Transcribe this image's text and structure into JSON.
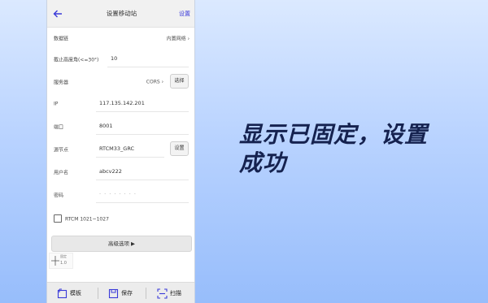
{
  "header": {
    "title": "设置移动站",
    "action_label": "设置"
  },
  "rows": {
    "datalink": {
      "label": "数据链",
      "value": "内置网络"
    },
    "cutoff": {
      "label": "截止高度角(<=30°)",
      "value": "10"
    },
    "server": {
      "label": "服务器",
      "value": "CORS",
      "button": "选择"
    },
    "ip": {
      "label": "IP",
      "value": "117.135.142.201"
    },
    "port": {
      "label": "端口",
      "value": "8001"
    },
    "mountpoint": {
      "label": "源节点",
      "value": "RTCM33_GRC",
      "button": "设置"
    },
    "username": {
      "label": "用户名",
      "value": "abcv222"
    },
    "password": {
      "label": "密码",
      "value": "· · · · · · · ·"
    },
    "rtcm": {
      "label": "RTCM 1021~1027",
      "checked": false
    }
  },
  "advanced": {
    "label": "高级选项 ▶"
  },
  "cross_widget": {
    "line1": "固定",
    "line2": "1.0"
  },
  "bottom": {
    "template": "模板",
    "save": "保存",
    "scan": "扫描"
  },
  "caption": {
    "text": "显示已固定，设置成功"
  }
}
